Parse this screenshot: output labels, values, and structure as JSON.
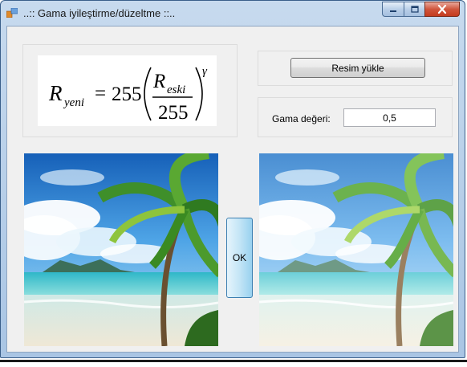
{
  "window": {
    "title": "..:: Gama iyileştirme/düzeltme ::.."
  },
  "formula": {
    "lhs_symbol": "R",
    "lhs_subscript": "yeni",
    "equals": "=",
    "constant": "255",
    "numerator_symbol": "R",
    "numerator_subscript": "eski",
    "denominator": "255",
    "exponent": "γ"
  },
  "controls": {
    "load_button_label": "Resim yükle",
    "gamma_label": "Gama değeri:",
    "gamma_value": "0,5",
    "ok_button_label": "OK"
  },
  "colors": {
    "window_border": "#3a5f8a",
    "client_bg": "#f0f0f0",
    "close_button": "#c43b1f"
  }
}
